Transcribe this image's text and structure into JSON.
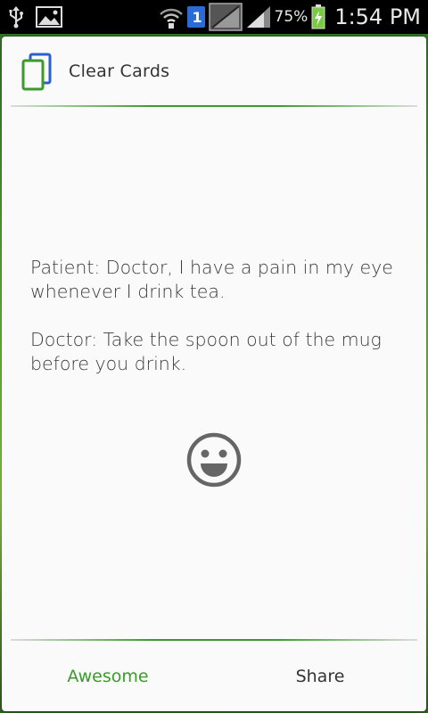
{
  "status_bar": {
    "battery": "75%",
    "time": "1:54 PM",
    "notification_count": "1"
  },
  "dialog": {
    "title": "Clear Cards",
    "joke": {
      "patient": "Patient: Doctor, I have a pain in my eye whenever I drink tea.",
      "doctor": "Doctor: Take the spoon out of the mug before you drink."
    },
    "buttons": {
      "awesome": "Awesome",
      "share": "Share"
    }
  },
  "colors": {
    "accent_green": "#3a9b2a",
    "dialog_bg": "#fafafa",
    "text": "#3b3b3b"
  }
}
